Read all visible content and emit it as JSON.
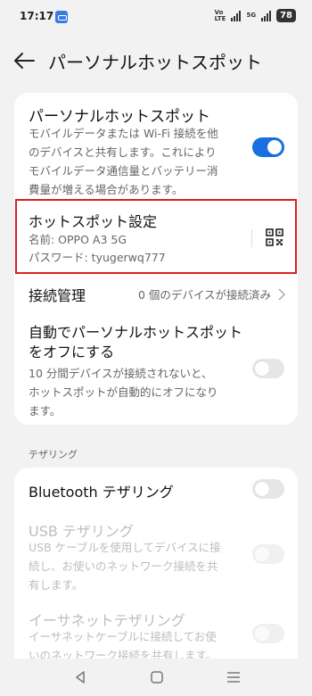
{
  "status_bar": {
    "time": "17:17",
    "volte": "Vo",
    "lte": "LTE",
    "net": "5G",
    "battery": "78"
  },
  "header": {
    "title": "パーソナルホットスポット"
  },
  "hotspot_toggle": {
    "title": "パーソナルホットスポット",
    "description_lines": [
      "モバイルデータまたは Wi-Fi 接続を他",
      "のデバイスと共有します。これにより",
      "モバイルデータ通信量とバッテリー消",
      "費量が増える場合があります。"
    ],
    "state": "on"
  },
  "hotspot_settings": {
    "title": "ホットスポット設定",
    "name_line": "名前: OPPO A3 5G",
    "password_line": "パスワード: tyugerwq777"
  },
  "connection": {
    "label": "接続管理",
    "value": "0 個のデバイスが接続済み"
  },
  "auto_off": {
    "title_lines": [
      "自動でパーソナルホットスポット",
      "をオフにする"
    ],
    "description_lines": [
      "10 分間デバイスが接続されないと、",
      "ホットスポットが自動的にオフになり",
      "ます。"
    ],
    "state": "off"
  },
  "tethering_section": {
    "label": "テザリング"
  },
  "bluetooth": {
    "title": "Bluetooth テザリング",
    "state": "off"
  },
  "usb": {
    "title": "USB テザリング",
    "description_lines": [
      "USB ケーブルを使用してデバイスに接",
      "続し、お使いのネットワーク接続を共",
      "有します。"
    ],
    "state": "disabled"
  },
  "ethernet": {
    "title": "イーサネットテザリング",
    "description_lines": [
      "イーサネットケーブルに接続してお使",
      "いのネットワーク接続を共有します。"
    ],
    "state": "disabled"
  },
  "colors": {
    "accent": "#1a6fe0",
    "highlight": "#d52222"
  }
}
